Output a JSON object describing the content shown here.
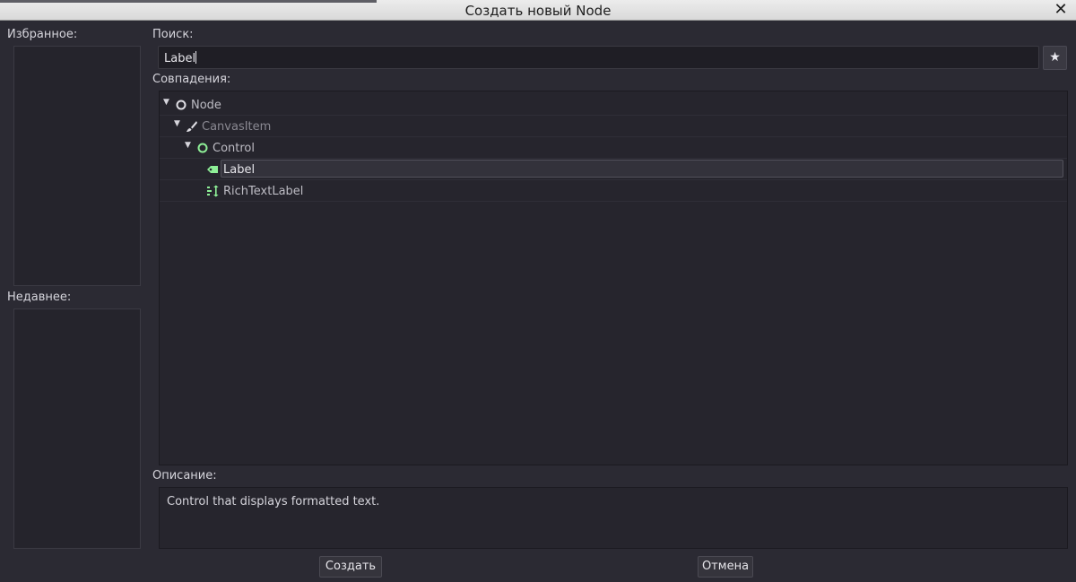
{
  "window": {
    "title": "Создать новый Node"
  },
  "favorites": {
    "label": "Избранное:"
  },
  "recent": {
    "label": "Недавнее:"
  },
  "search": {
    "label": "Поиск:",
    "value": "Label"
  },
  "matches": {
    "label": "Совпадения:",
    "items": [
      {
        "text": "Node",
        "icon": "node-circle-icon",
        "color": "#bdbcc4"
      },
      {
        "text": "CanvasItem",
        "icon": "brush-icon",
        "color": "#8a8992"
      },
      {
        "text": "Control",
        "icon": "control-circle-icon",
        "color": "#bdbcc4"
      },
      {
        "text": "Label",
        "icon": "label-tag-icon",
        "color": "#e6e5ea"
      },
      {
        "text": "RichTextLabel",
        "icon": "rich-text-icon",
        "color": "#bdbcc4"
      }
    ]
  },
  "description": {
    "label": "Описание:",
    "text": "Control that displays formatted text."
  },
  "buttons": {
    "create": "Создать",
    "cancel": "Отмена"
  },
  "colors": {
    "accent_green": "#8eef97",
    "background": "#2b2a33"
  }
}
